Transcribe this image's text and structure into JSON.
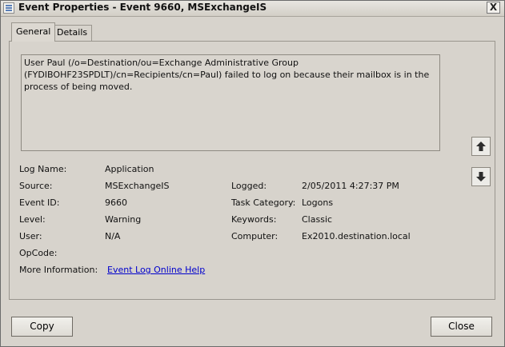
{
  "window": {
    "title": "Event Properties - Event 9660, MSExchangeIS",
    "close_glyph": "X"
  },
  "tabs": [
    {
      "label": "General"
    },
    {
      "label": "Details"
    }
  ],
  "description": "User Paul (/o=Destination/ou=Exchange Administrative Group (FYDIBOHF23SPDLT)/cn=Recipients/cn=Paul) failed to log on because their mailbox is in the process of being moved.",
  "fields": {
    "log_name": {
      "label": "Log Name:",
      "value": "Application"
    },
    "source": {
      "label": "Source:",
      "value": "MSExchangeIS"
    },
    "event_id": {
      "label": "Event ID:",
      "value": "9660"
    },
    "level": {
      "label": "Level:",
      "value": "Warning"
    },
    "user": {
      "label": "User:",
      "value": "N/A"
    },
    "opcode": {
      "label": "OpCode:",
      "value": ""
    },
    "more_info": {
      "label": "More Information:",
      "value": "Event Log Online Help"
    },
    "logged": {
      "label": "Logged:",
      "value": "2/05/2011 4:27:37 PM"
    },
    "task_category": {
      "label": "Task Category:",
      "value": "Logons"
    },
    "keywords": {
      "label": "Keywords:",
      "value": "Classic"
    },
    "computer": {
      "label": "Computer:",
      "value": "Ex2010.destination.local"
    }
  },
  "buttons": {
    "copy": "Copy",
    "close": "Close"
  },
  "icons": {
    "up": "up-arrow-icon",
    "down": "down-arrow-icon",
    "title": "event-viewer-icon"
  }
}
